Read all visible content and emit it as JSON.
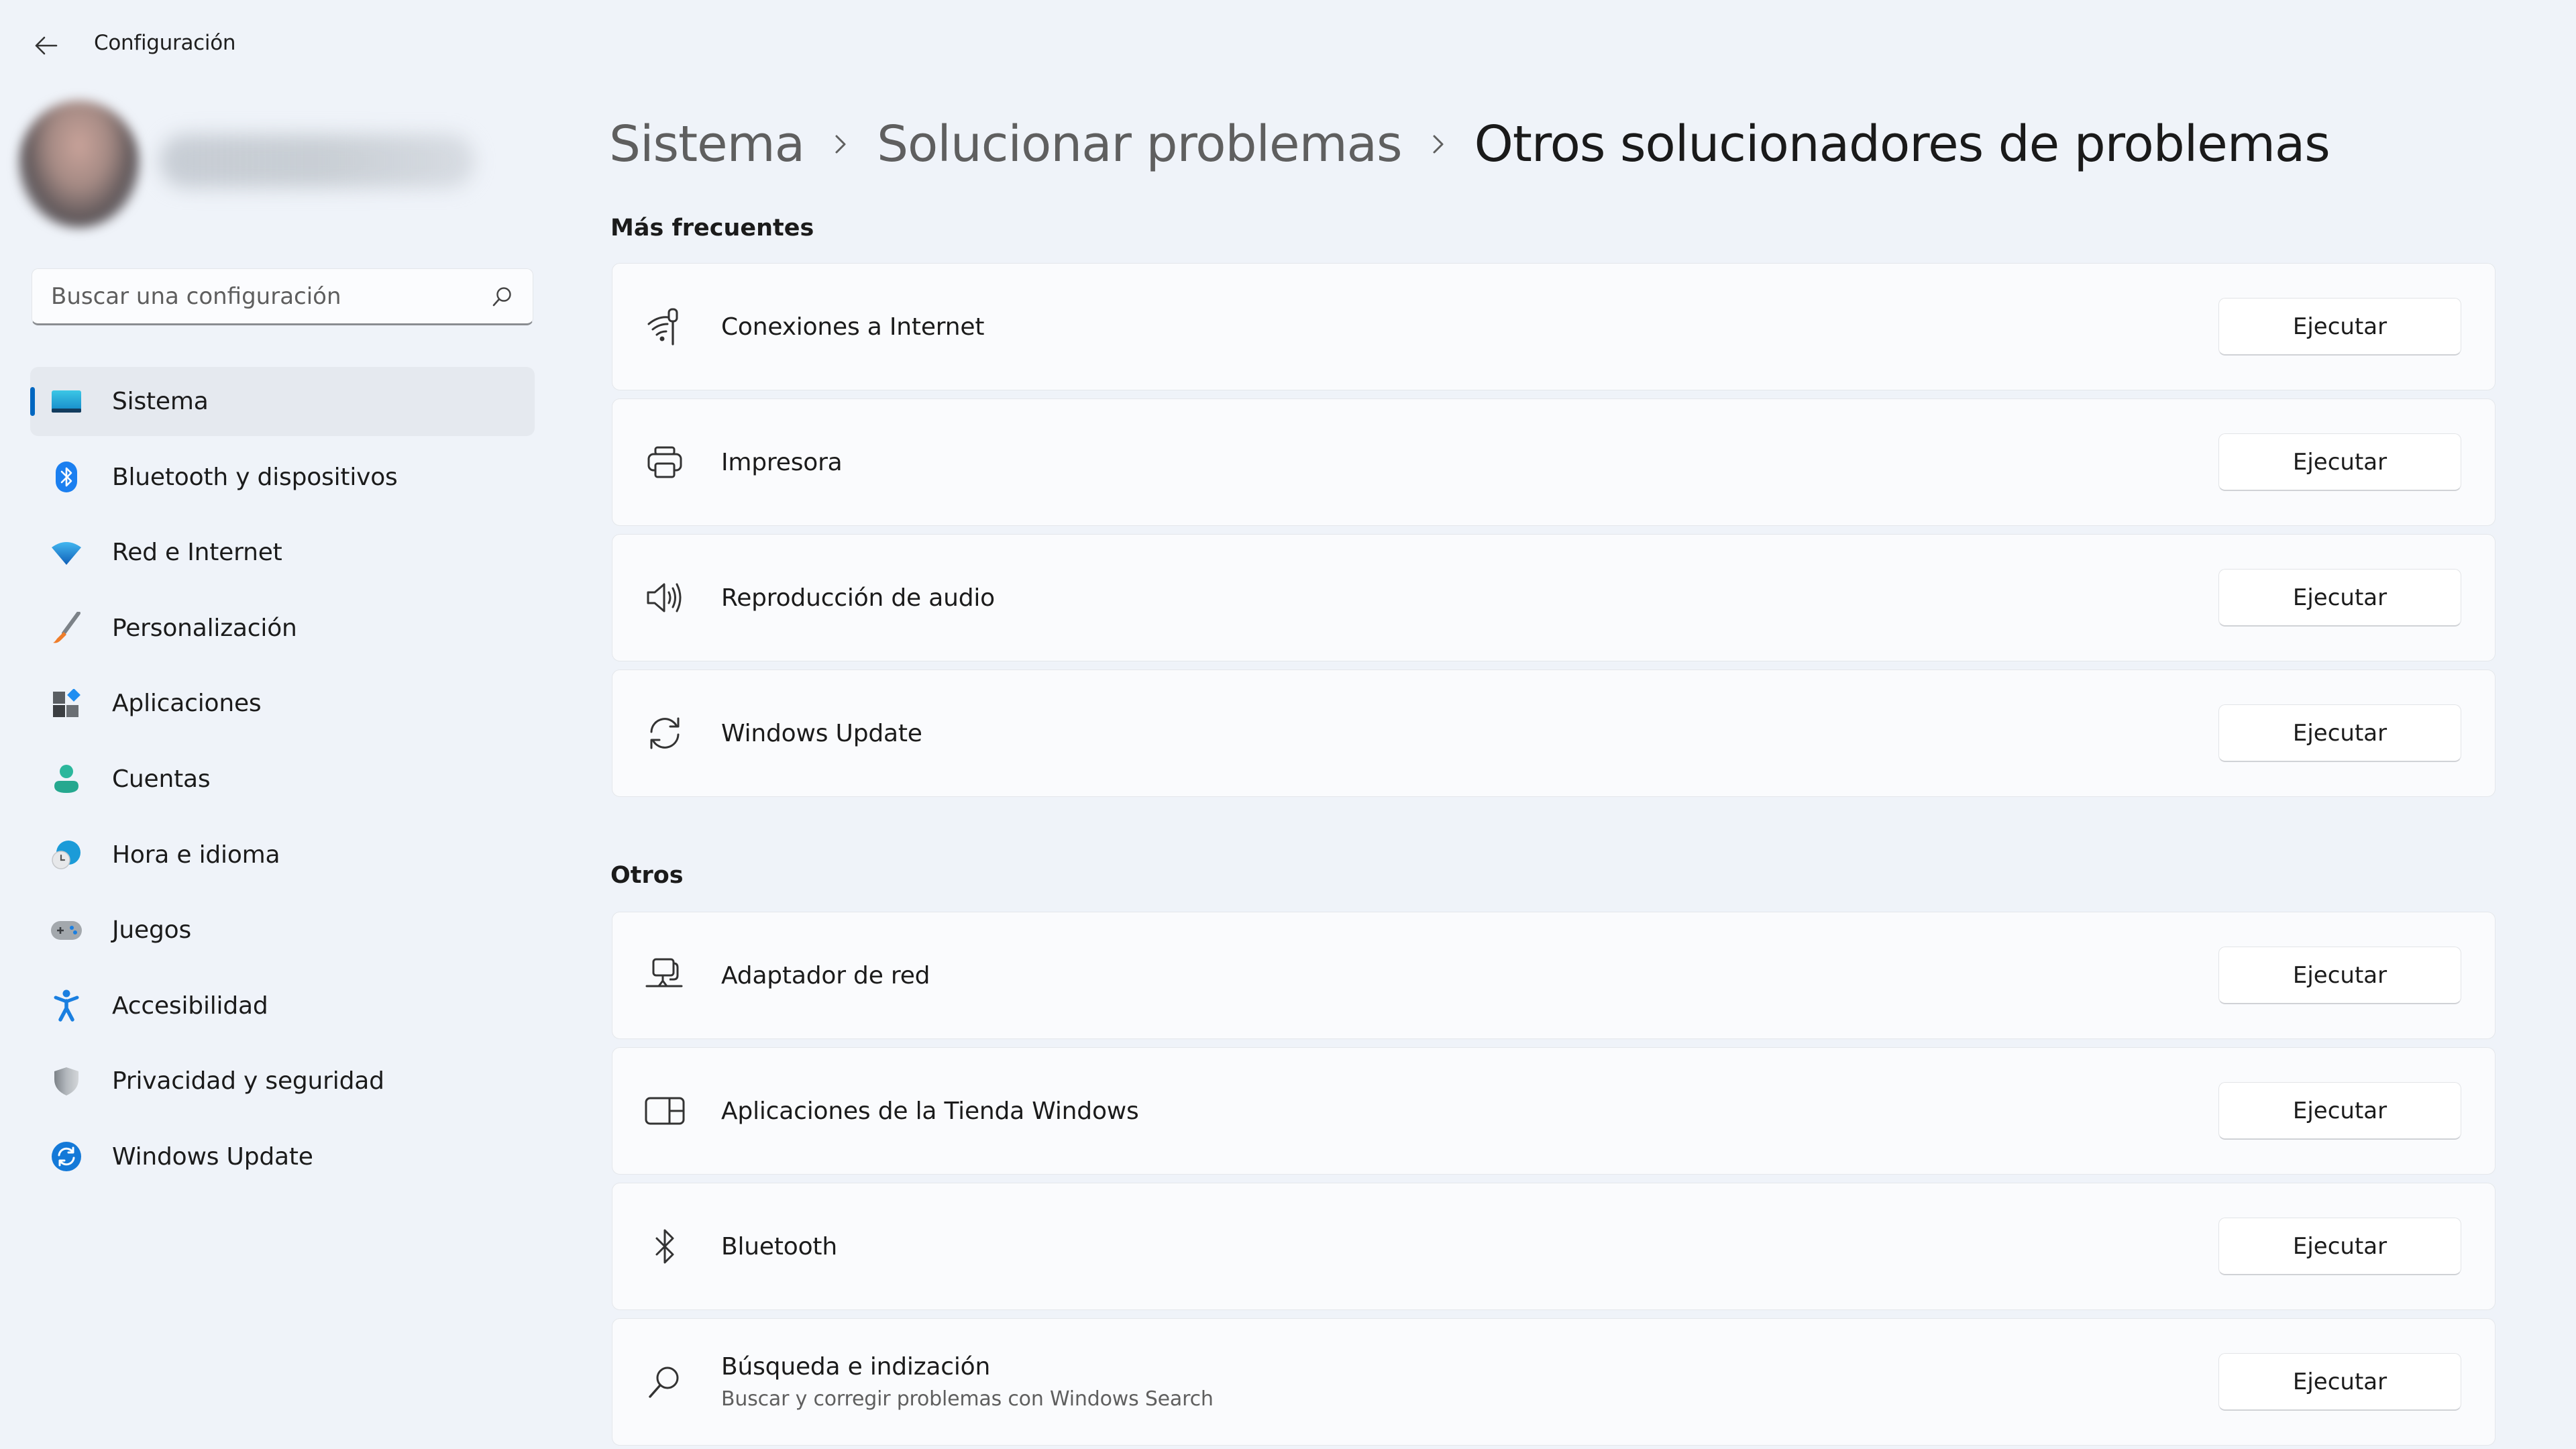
{
  "window": {
    "title": "Configuración",
    "back_icon": "arrow-left-icon"
  },
  "profile": {
    "avatar": "blurred-user-photo",
    "name": "(blurred)"
  },
  "search": {
    "placeholder": "Buscar una configuración",
    "value": "",
    "icon": "search-icon"
  },
  "sidebar": {
    "selected_index": 0,
    "items": [
      {
        "label": "Sistema",
        "icon": "system-display-icon",
        "color": "#1ea2d6"
      },
      {
        "label": "Bluetooth y dispositivos",
        "icon": "bluetooth-icon",
        "color": "#1b7ff0"
      },
      {
        "label": "Red e Internet",
        "icon": "wifi-icon",
        "color": "#1a86d8"
      },
      {
        "label": "Personalización",
        "icon": "paintbrush-icon",
        "color": "#ef7d2a"
      },
      {
        "label": "Aplicaciones",
        "icon": "apps-icon",
        "color": "#1f8ef1"
      },
      {
        "label": "Cuentas",
        "icon": "account-icon",
        "color": "#25b49a"
      },
      {
        "label": "Hora e idioma",
        "icon": "time-language-icon",
        "color": "#1b9bd8"
      },
      {
        "label": "Juegos",
        "icon": "gamepad-icon",
        "color": "#9aa0a6"
      },
      {
        "label": "Accesibilidad",
        "icon": "accessibility-icon",
        "color": "#1a7fe0"
      },
      {
        "label": "Privacidad y seguridad",
        "icon": "shield-icon",
        "color": "#8e949b"
      },
      {
        "label": "Windows Update",
        "icon": "windows-update-icon",
        "color": "#1479d8"
      }
    ]
  },
  "breadcrumb": {
    "items": [
      "Sistema",
      "Solucionar problemas",
      "Otros solucionadores de problemas"
    ],
    "separator_icon": "chevron-right-icon"
  },
  "sections": [
    {
      "title": "Más frecuentes",
      "items": [
        {
          "title": "Conexiones a Internet",
          "description": "",
          "icon": "internet-connection-icon",
          "button": "Ejecutar"
        },
        {
          "title": "Impresora",
          "description": "",
          "icon": "printer-icon",
          "button": "Ejecutar"
        },
        {
          "title": "Reproducción de audio",
          "description": "",
          "icon": "speaker-icon",
          "button": "Ejecutar"
        },
        {
          "title": "Windows Update",
          "description": "",
          "icon": "sync-icon",
          "button": "Ejecutar"
        }
      ]
    },
    {
      "title": "Otros",
      "items": [
        {
          "title": "Adaptador de red",
          "description": "",
          "icon": "network-adapter-icon",
          "button": "Ejecutar"
        },
        {
          "title": "Aplicaciones de la Tienda Windows",
          "description": "",
          "icon": "store-apps-icon",
          "button": "Ejecutar"
        },
        {
          "title": "Bluetooth",
          "description": "",
          "icon": "bluetooth-icon",
          "button": "Ejecutar"
        },
        {
          "title": "Búsqueda e indización",
          "description": "Buscar y corregir problemas con Windows Search",
          "icon": "search-icon",
          "button": "Ejecutar"
        }
      ]
    }
  ],
  "colors": {
    "accent": "#0067c0",
    "background": "#eff3f9",
    "card": "#fafbfd",
    "selected_nav": "#e5e9ef"
  }
}
